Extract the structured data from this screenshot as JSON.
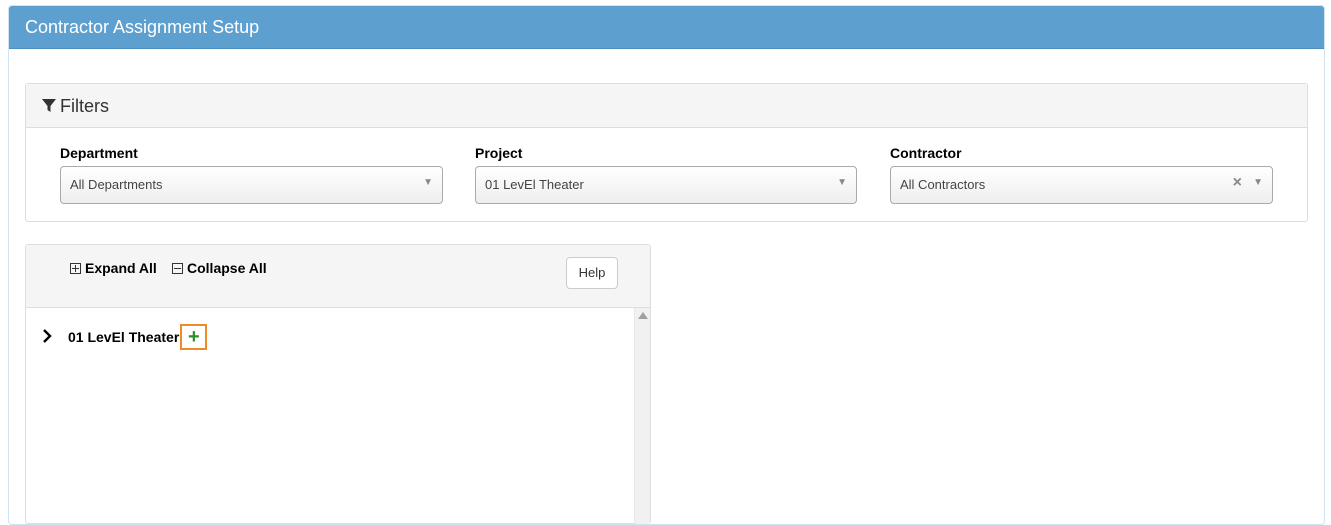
{
  "header": {
    "title": "Contractor Assignment Setup"
  },
  "filters": {
    "title": "Filters",
    "department": {
      "label": "Department",
      "value": "All Departments"
    },
    "project": {
      "label": "Project",
      "value": "01 LevEl Theater"
    },
    "contractor": {
      "label": "Contractor",
      "value": "All Contractors",
      "clear": "×"
    }
  },
  "tree": {
    "expand_all": "Expand All",
    "collapse_all": "Collapse All",
    "help": "Help",
    "nodes": [
      {
        "label": "01 LevEl Theater",
        "add": "+"
      }
    ]
  },
  "colors": {
    "header_bg": "#5d9fcf",
    "highlight": "#f08a24",
    "add_icon": "#2e8b2e"
  }
}
